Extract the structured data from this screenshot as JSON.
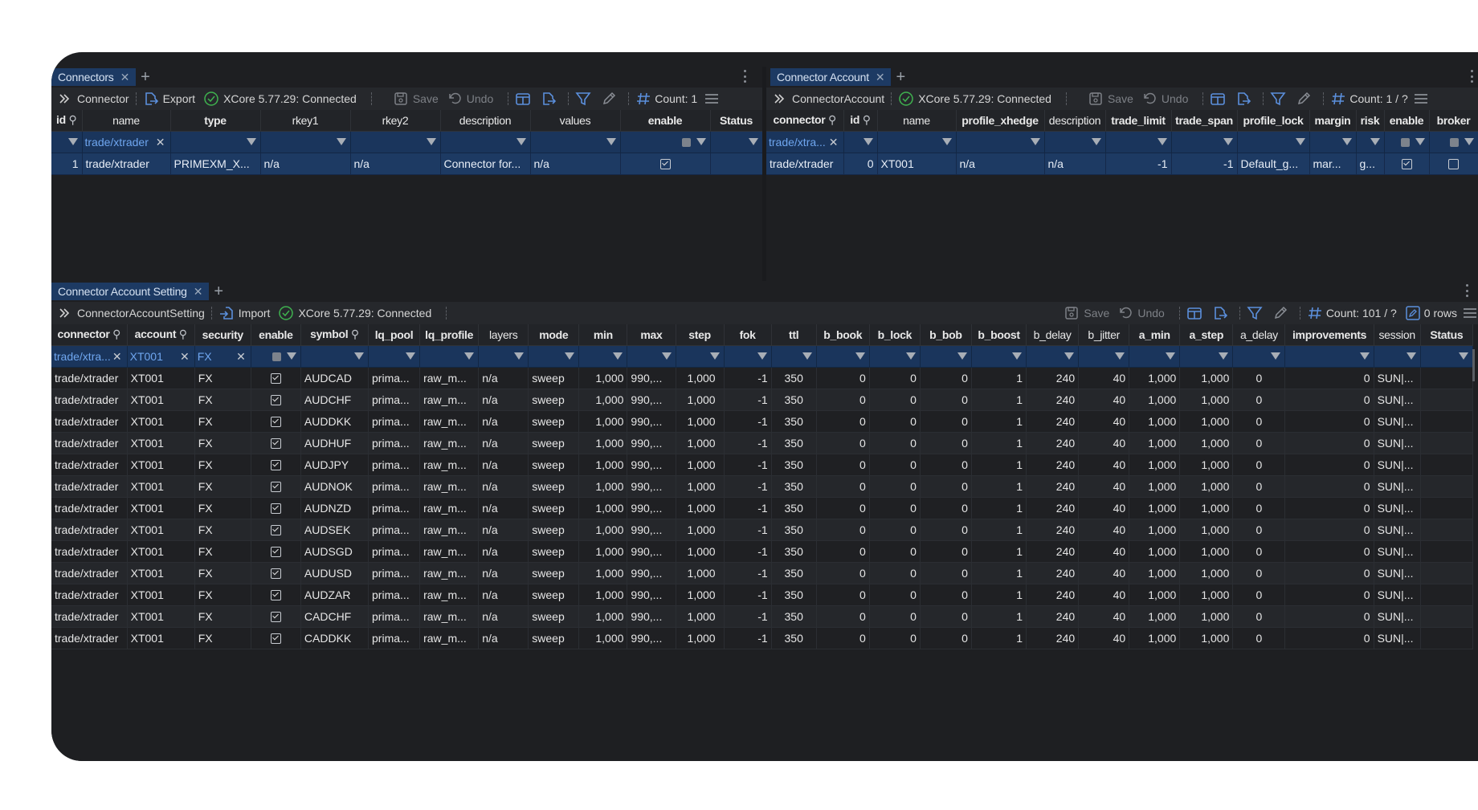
{
  "panels": {
    "connectors": {
      "tab_label": "Connectors",
      "toolbar": {
        "title": "Connector",
        "export_label": "Export",
        "status": "XCore 5.77.29: Connected",
        "save_label": "Save",
        "undo_label": "Undo",
        "count_label": "Count: 1"
      },
      "columns": [
        "id",
        "name",
        "type",
        "rkey1",
        "rkey2",
        "description",
        "values",
        "enable",
        "Status"
      ],
      "filters": {
        "name": "trade/xtrader"
      },
      "rows": [
        {
          "id": "1",
          "name": "trade/xtrader",
          "type": "PRIMEXM_X...",
          "rkey1": "n/a",
          "rkey2": "n/a",
          "description": "Connector for...",
          "values": "n/a",
          "enable": true,
          "Status": ""
        }
      ]
    },
    "connector_account": {
      "tab_label": "Connector Account",
      "toolbar": {
        "title": "ConnectorAccount",
        "status": "XCore 5.77.29: Connected",
        "save_label": "Save",
        "undo_label": "Undo",
        "count_label": "Count: 1 / ?"
      },
      "columns": [
        "connector",
        "id",
        "name",
        "profile_xhedge",
        "description",
        "trade_limit",
        "trade_span",
        "profile_lock",
        "margin",
        "risk",
        "enable",
        "broker"
      ],
      "filters": {
        "connector": "trade/xtra..."
      },
      "rows": [
        {
          "connector": "trade/xtrader",
          "id": "0",
          "name": "XT001",
          "profile_xhedge": "n/a",
          "description": "n/a",
          "trade_limit": "-1",
          "trade_span": "-1",
          "profile_lock": "Default_g...",
          "margin": "mar...",
          "risk": "g...",
          "enable": true,
          "broker": false
        }
      ]
    },
    "connector_account_setting": {
      "tab_label": "Connector Account Setting",
      "toolbar": {
        "title": "ConnectorAccountSetting",
        "import_label": "Import",
        "status": "XCore 5.77.29: Connected",
        "save_label": "Save",
        "undo_label": "Undo",
        "count_label": "Count: 101 / ?",
        "rows_label": "0 rows"
      },
      "columns": [
        "connector",
        "account",
        "security",
        "enable",
        "symbol",
        "lq_pool",
        "lq_profile",
        "layers",
        "mode",
        "min",
        "max",
        "step",
        "fok",
        "ttl",
        "b_book",
        "b_lock",
        "b_bob",
        "b_boost",
        "b_delay",
        "b_jitter",
        "a_min",
        "a_step",
        "a_delay",
        "improvements",
        "session",
        "Status"
      ],
      "filters": {
        "connector": "trade/xtra...",
        "account": "XT001",
        "security": "FX"
      },
      "rows": [
        {
          "connector": "trade/xtrader",
          "account": "XT001",
          "security": "FX",
          "enable": true,
          "symbol": "AUDCAD",
          "lq_pool": "prima...",
          "lq_profile": "raw_m...",
          "layers": "n/a",
          "mode": "sweep",
          "min": "1,000",
          "max": "990,...",
          "step": "1,000",
          "fok": "-1",
          "ttl": "350",
          "b_book": "0",
          "b_lock": "0",
          "b_bob": "0",
          "b_boost": "1",
          "b_delay": "240",
          "b_jitter": "40",
          "a_min": "1,000",
          "a_step": "1,000",
          "a_delay": "0",
          "improvements": "0",
          "session": "SUN|...",
          "Status": ""
        },
        {
          "connector": "trade/xtrader",
          "account": "XT001",
          "security": "FX",
          "enable": true,
          "symbol": "AUDCHF",
          "lq_pool": "prima...",
          "lq_profile": "raw_m...",
          "layers": "n/a",
          "mode": "sweep",
          "min": "1,000",
          "max": "990,...",
          "step": "1,000",
          "fok": "-1",
          "ttl": "350",
          "b_book": "0",
          "b_lock": "0",
          "b_bob": "0",
          "b_boost": "1",
          "b_delay": "240",
          "b_jitter": "40",
          "a_min": "1,000",
          "a_step": "1,000",
          "a_delay": "0",
          "improvements": "0",
          "session": "SUN|...",
          "Status": ""
        },
        {
          "connector": "trade/xtrader",
          "account": "XT001",
          "security": "FX",
          "enable": true,
          "symbol": "AUDDKK",
          "lq_pool": "prima...",
          "lq_profile": "raw_m...",
          "layers": "n/a",
          "mode": "sweep",
          "min": "1,000",
          "max": "990,...",
          "step": "1,000",
          "fok": "-1",
          "ttl": "350",
          "b_book": "0",
          "b_lock": "0",
          "b_bob": "0",
          "b_boost": "1",
          "b_delay": "240",
          "b_jitter": "40",
          "a_min": "1,000",
          "a_step": "1,000",
          "a_delay": "0",
          "improvements": "0",
          "session": "SUN|...",
          "Status": ""
        },
        {
          "connector": "trade/xtrader",
          "account": "XT001",
          "security": "FX",
          "enable": true,
          "symbol": "AUDHUF",
          "lq_pool": "prima...",
          "lq_profile": "raw_m...",
          "layers": "n/a",
          "mode": "sweep",
          "min": "1,000",
          "max": "990,...",
          "step": "1,000",
          "fok": "-1",
          "ttl": "350",
          "b_book": "0",
          "b_lock": "0",
          "b_bob": "0",
          "b_boost": "1",
          "b_delay": "240",
          "b_jitter": "40",
          "a_min": "1,000",
          "a_step": "1,000",
          "a_delay": "0",
          "improvements": "0",
          "session": "SUN|...",
          "Status": ""
        },
        {
          "connector": "trade/xtrader",
          "account": "XT001",
          "security": "FX",
          "enable": true,
          "symbol": "AUDJPY",
          "lq_pool": "prima...",
          "lq_profile": "raw_m...",
          "layers": "n/a",
          "mode": "sweep",
          "min": "1,000",
          "max": "990,...",
          "step": "1,000",
          "fok": "-1",
          "ttl": "350",
          "b_book": "0",
          "b_lock": "0",
          "b_bob": "0",
          "b_boost": "1",
          "b_delay": "240",
          "b_jitter": "40",
          "a_min": "1,000",
          "a_step": "1,000",
          "a_delay": "0",
          "improvements": "0",
          "session": "SUN|...",
          "Status": ""
        },
        {
          "connector": "trade/xtrader",
          "account": "XT001",
          "security": "FX",
          "enable": true,
          "symbol": "AUDNOK",
          "lq_pool": "prima...",
          "lq_profile": "raw_m...",
          "layers": "n/a",
          "mode": "sweep",
          "min": "1,000",
          "max": "990,...",
          "step": "1,000",
          "fok": "-1",
          "ttl": "350",
          "b_book": "0",
          "b_lock": "0",
          "b_bob": "0",
          "b_boost": "1",
          "b_delay": "240",
          "b_jitter": "40",
          "a_min": "1,000",
          "a_step": "1,000",
          "a_delay": "0",
          "improvements": "0",
          "session": "SUN|...",
          "Status": ""
        },
        {
          "connector": "trade/xtrader",
          "account": "XT001",
          "security": "FX",
          "enable": true,
          "symbol": "AUDNZD",
          "lq_pool": "prima...",
          "lq_profile": "raw_m...",
          "layers": "n/a",
          "mode": "sweep",
          "min": "1,000",
          "max": "990,...",
          "step": "1,000",
          "fok": "-1",
          "ttl": "350",
          "b_book": "0",
          "b_lock": "0",
          "b_bob": "0",
          "b_boost": "1",
          "b_delay": "240",
          "b_jitter": "40",
          "a_min": "1,000",
          "a_step": "1,000",
          "a_delay": "0",
          "improvements": "0",
          "session": "SUN|...",
          "Status": ""
        },
        {
          "connector": "trade/xtrader",
          "account": "XT001",
          "security": "FX",
          "enable": true,
          "symbol": "AUDSEK",
          "lq_pool": "prima...",
          "lq_profile": "raw_m...",
          "layers": "n/a",
          "mode": "sweep",
          "min": "1,000",
          "max": "990,...",
          "step": "1,000",
          "fok": "-1",
          "ttl": "350",
          "b_book": "0",
          "b_lock": "0",
          "b_bob": "0",
          "b_boost": "1",
          "b_delay": "240",
          "b_jitter": "40",
          "a_min": "1,000",
          "a_step": "1,000",
          "a_delay": "0",
          "improvements": "0",
          "session": "SUN|...",
          "Status": ""
        },
        {
          "connector": "trade/xtrader",
          "account": "XT001",
          "security": "FX",
          "enable": true,
          "symbol": "AUDSGD",
          "lq_pool": "prima...",
          "lq_profile": "raw_m...",
          "layers": "n/a",
          "mode": "sweep",
          "min": "1,000",
          "max": "990,...",
          "step": "1,000",
          "fok": "-1",
          "ttl": "350",
          "b_book": "0",
          "b_lock": "0",
          "b_bob": "0",
          "b_boost": "1",
          "b_delay": "240",
          "b_jitter": "40",
          "a_min": "1,000",
          "a_step": "1,000",
          "a_delay": "0",
          "improvements": "0",
          "session": "SUN|...",
          "Status": ""
        },
        {
          "connector": "trade/xtrader",
          "account": "XT001",
          "security": "FX",
          "enable": true,
          "symbol": "AUDUSD",
          "lq_pool": "prima...",
          "lq_profile": "raw_m...",
          "layers": "n/a",
          "mode": "sweep",
          "min": "1,000",
          "max": "990,...",
          "step": "1,000",
          "fok": "-1",
          "ttl": "350",
          "b_book": "0",
          "b_lock": "0",
          "b_bob": "0",
          "b_boost": "1",
          "b_delay": "240",
          "b_jitter": "40",
          "a_min": "1,000",
          "a_step": "1,000",
          "a_delay": "0",
          "improvements": "0",
          "session": "SUN|...",
          "Status": ""
        },
        {
          "connector": "trade/xtrader",
          "account": "XT001",
          "security": "FX",
          "enable": true,
          "symbol": "AUDZAR",
          "lq_pool": "prima...",
          "lq_profile": "raw_m...",
          "layers": "n/a",
          "mode": "sweep",
          "min": "1,000",
          "max": "990,...",
          "step": "1,000",
          "fok": "-1",
          "ttl": "350",
          "b_book": "0",
          "b_lock": "0",
          "b_bob": "0",
          "b_boost": "1",
          "b_delay": "240",
          "b_jitter": "40",
          "a_min": "1,000",
          "a_step": "1,000",
          "a_delay": "0",
          "improvements": "0",
          "session": "SUN|...",
          "Status": ""
        },
        {
          "connector": "trade/xtrader",
          "account": "XT001",
          "security": "FX",
          "enable": true,
          "symbol": "CADCHF",
          "lq_pool": "prima...",
          "lq_profile": "raw_m...",
          "layers": "n/a",
          "mode": "sweep",
          "min": "1,000",
          "max": "990,...",
          "step": "1,000",
          "fok": "-1",
          "ttl": "350",
          "b_book": "0",
          "b_lock": "0",
          "b_bob": "0",
          "b_boost": "1",
          "b_delay": "240",
          "b_jitter": "40",
          "a_min": "1,000",
          "a_step": "1,000",
          "a_delay": "0",
          "improvements": "0",
          "session": "SUN|...",
          "Status": ""
        },
        {
          "connector": "trade/xtrader",
          "account": "XT001",
          "security": "FX",
          "enable": true,
          "symbol": "CADDKK",
          "lq_pool": "prima...",
          "lq_profile": "raw_m...",
          "layers": "n/a",
          "mode": "sweep",
          "min": "1,000",
          "max": "990,...",
          "step": "1,000",
          "fok": "-1",
          "ttl": "350",
          "b_book": "0",
          "b_lock": "0",
          "b_bob": "0",
          "b_boost": "1",
          "b_delay": "240",
          "b_jitter": "40",
          "a_min": "1,000",
          "a_step": "1,000",
          "a_delay": "0",
          "improvements": "0",
          "session": "SUN|...",
          "Status": ""
        }
      ]
    }
  },
  "colors": {
    "accent": "#5b8fdc",
    "selected_row": "#1d3a63",
    "status_ok": "#3fb34f",
    "background": "#1e1f22"
  }
}
